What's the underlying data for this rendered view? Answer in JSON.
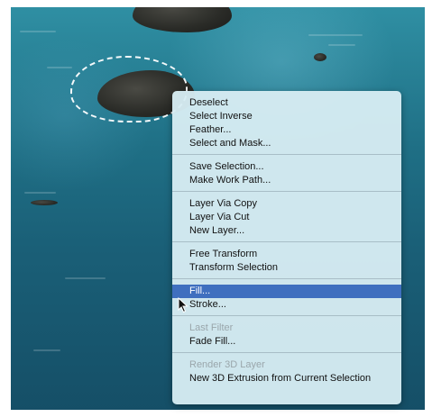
{
  "menu": {
    "items": [
      {
        "label": "Deselect"
      },
      {
        "label": "Select Inverse"
      },
      {
        "label": "Feather..."
      },
      {
        "label": "Select and Mask..."
      },
      {
        "label": "Save Selection..."
      },
      {
        "label": "Make Work Path..."
      },
      {
        "label": "Layer Via Copy"
      },
      {
        "label": "Layer Via Cut"
      },
      {
        "label": "New Layer..."
      },
      {
        "label": "Free Transform"
      },
      {
        "label": "Transform Selection"
      },
      {
        "label": "Fill..."
      },
      {
        "label": "Stroke..."
      },
      {
        "label": "Last Filter"
      },
      {
        "label": "Fade Fill..."
      },
      {
        "label": "Render 3D Layer"
      },
      {
        "label": "New 3D Extrusion from Current Selection"
      }
    ]
  }
}
